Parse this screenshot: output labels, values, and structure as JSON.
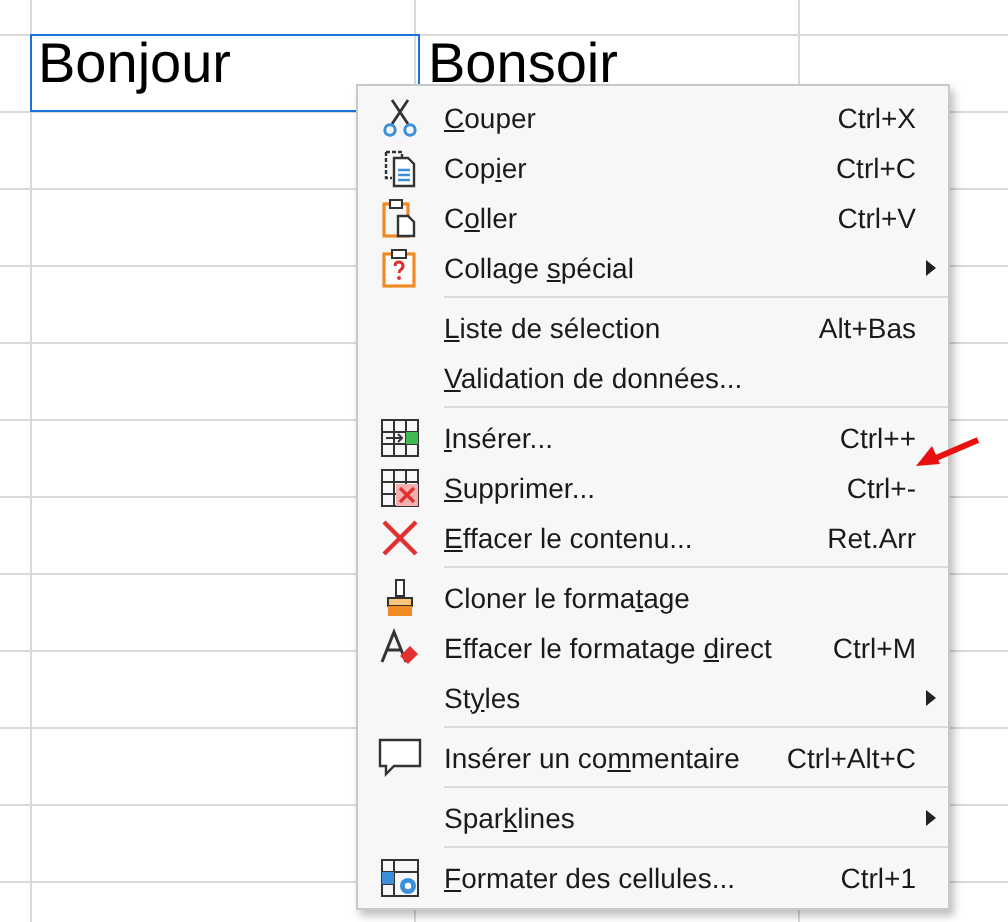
{
  "sheet": {
    "cells": [
      {
        "text": "Bonjour",
        "selected": true
      },
      {
        "text": "Bonsoir",
        "selected": false
      }
    ]
  },
  "context_menu": {
    "items": [
      {
        "kind": "item",
        "label": {
          "key": "C",
          "after": "ouper"
        },
        "shortcut": "Ctrl+X",
        "submenu": false
      },
      {
        "kind": "item",
        "label": {
          "before": "Cop",
          "key": "i",
          "after": "er"
        },
        "shortcut": "Ctrl+C",
        "submenu": false
      },
      {
        "kind": "item",
        "label": {
          "before": "C",
          "key": "o",
          "after": "ller"
        },
        "shortcut": "Ctrl+V",
        "submenu": false
      },
      {
        "kind": "item",
        "label": {
          "before": "Collage ",
          "key": "s",
          "after": "pécial"
        },
        "submenu": true
      },
      {
        "kind": "separator"
      },
      {
        "kind": "item",
        "label": {
          "key": "L",
          "after": "iste de sélection"
        },
        "shortcut": "Alt+Bas",
        "submenu": false
      },
      {
        "kind": "item",
        "label": {
          "key": "V",
          "after": "alidation de données..."
        },
        "submenu": false
      },
      {
        "kind": "separator"
      },
      {
        "kind": "item",
        "label": {
          "key": "I",
          "after": "nsérer..."
        },
        "shortcut": "Ctrl++",
        "submenu": false
      },
      {
        "kind": "item",
        "label": {
          "key": "S",
          "after": "upprimer..."
        },
        "shortcut": "Ctrl+-",
        "submenu": false
      },
      {
        "kind": "item",
        "label": {
          "key": "E",
          "after": "ffacer le contenu..."
        },
        "shortcut": "Ret.Arr",
        "submenu": false
      },
      {
        "kind": "separator"
      },
      {
        "kind": "item",
        "label": {
          "before": "Cloner le forma",
          "key": "t",
          "after": "age"
        },
        "submenu": false
      },
      {
        "kind": "item",
        "label": {
          "before": "Effacer le formatage ",
          "key": "d",
          "after": "irect"
        },
        "shortcut": "Ctrl+M",
        "submenu": false
      },
      {
        "kind": "item",
        "label": {
          "before": "St",
          "key": "y",
          "after": "les"
        },
        "submenu": true
      },
      {
        "kind": "separator"
      },
      {
        "kind": "item",
        "label": {
          "before": "Insérer un co",
          "key": "m",
          "after": "mentaire"
        },
        "shortcut": "Ctrl+Alt+C",
        "submenu": false
      },
      {
        "kind": "separator"
      },
      {
        "kind": "item",
        "label": {
          "before": "Spar",
          "key": "k",
          "after": "lines"
        },
        "submenu": true
      },
      {
        "kind": "separator"
      },
      {
        "kind": "item",
        "label": {
          "key": "F",
          "after": "ormater des cellules..."
        },
        "shortcut": "Ctrl+1",
        "submenu": false
      }
    ]
  }
}
